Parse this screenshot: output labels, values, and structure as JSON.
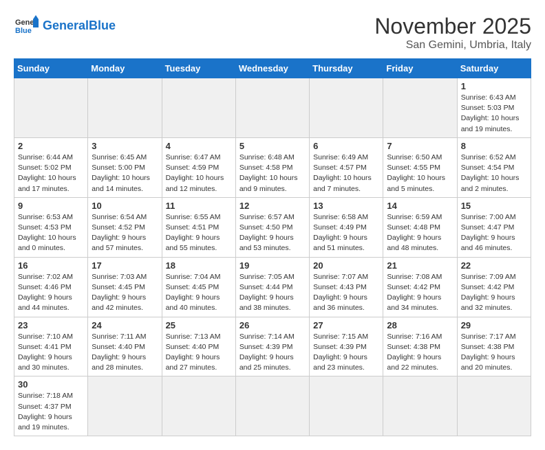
{
  "header": {
    "logo_general": "General",
    "logo_blue": "Blue",
    "month_title": "November 2025",
    "location": "San Gemini, Umbria, Italy"
  },
  "weekdays": [
    "Sunday",
    "Monday",
    "Tuesday",
    "Wednesday",
    "Thursday",
    "Friday",
    "Saturday"
  ],
  "weeks": [
    [
      {
        "day": "",
        "info": ""
      },
      {
        "day": "",
        "info": ""
      },
      {
        "day": "",
        "info": ""
      },
      {
        "day": "",
        "info": ""
      },
      {
        "day": "",
        "info": ""
      },
      {
        "day": "",
        "info": ""
      },
      {
        "day": "1",
        "info": "Sunrise: 6:43 AM\nSunset: 5:03 PM\nDaylight: 10 hours and 19 minutes."
      }
    ],
    [
      {
        "day": "2",
        "info": "Sunrise: 6:44 AM\nSunset: 5:02 PM\nDaylight: 10 hours and 17 minutes."
      },
      {
        "day": "3",
        "info": "Sunrise: 6:45 AM\nSunset: 5:00 PM\nDaylight: 10 hours and 14 minutes."
      },
      {
        "day": "4",
        "info": "Sunrise: 6:47 AM\nSunset: 4:59 PM\nDaylight: 10 hours and 12 minutes."
      },
      {
        "day": "5",
        "info": "Sunrise: 6:48 AM\nSunset: 4:58 PM\nDaylight: 10 hours and 9 minutes."
      },
      {
        "day": "6",
        "info": "Sunrise: 6:49 AM\nSunset: 4:57 PM\nDaylight: 10 hours and 7 minutes."
      },
      {
        "day": "7",
        "info": "Sunrise: 6:50 AM\nSunset: 4:55 PM\nDaylight: 10 hours and 5 minutes."
      },
      {
        "day": "8",
        "info": "Sunrise: 6:52 AM\nSunset: 4:54 PM\nDaylight: 10 hours and 2 minutes."
      }
    ],
    [
      {
        "day": "9",
        "info": "Sunrise: 6:53 AM\nSunset: 4:53 PM\nDaylight: 10 hours and 0 minutes."
      },
      {
        "day": "10",
        "info": "Sunrise: 6:54 AM\nSunset: 4:52 PM\nDaylight: 9 hours and 57 minutes."
      },
      {
        "day": "11",
        "info": "Sunrise: 6:55 AM\nSunset: 4:51 PM\nDaylight: 9 hours and 55 minutes."
      },
      {
        "day": "12",
        "info": "Sunrise: 6:57 AM\nSunset: 4:50 PM\nDaylight: 9 hours and 53 minutes."
      },
      {
        "day": "13",
        "info": "Sunrise: 6:58 AM\nSunset: 4:49 PM\nDaylight: 9 hours and 51 minutes."
      },
      {
        "day": "14",
        "info": "Sunrise: 6:59 AM\nSunset: 4:48 PM\nDaylight: 9 hours and 48 minutes."
      },
      {
        "day": "15",
        "info": "Sunrise: 7:00 AM\nSunset: 4:47 PM\nDaylight: 9 hours and 46 minutes."
      }
    ],
    [
      {
        "day": "16",
        "info": "Sunrise: 7:02 AM\nSunset: 4:46 PM\nDaylight: 9 hours and 44 minutes."
      },
      {
        "day": "17",
        "info": "Sunrise: 7:03 AM\nSunset: 4:45 PM\nDaylight: 9 hours and 42 minutes."
      },
      {
        "day": "18",
        "info": "Sunrise: 7:04 AM\nSunset: 4:45 PM\nDaylight: 9 hours and 40 minutes."
      },
      {
        "day": "19",
        "info": "Sunrise: 7:05 AM\nSunset: 4:44 PM\nDaylight: 9 hours and 38 minutes."
      },
      {
        "day": "20",
        "info": "Sunrise: 7:07 AM\nSunset: 4:43 PM\nDaylight: 9 hours and 36 minutes."
      },
      {
        "day": "21",
        "info": "Sunrise: 7:08 AM\nSunset: 4:42 PM\nDaylight: 9 hours and 34 minutes."
      },
      {
        "day": "22",
        "info": "Sunrise: 7:09 AM\nSunset: 4:42 PM\nDaylight: 9 hours and 32 minutes."
      }
    ],
    [
      {
        "day": "23",
        "info": "Sunrise: 7:10 AM\nSunset: 4:41 PM\nDaylight: 9 hours and 30 minutes."
      },
      {
        "day": "24",
        "info": "Sunrise: 7:11 AM\nSunset: 4:40 PM\nDaylight: 9 hours and 28 minutes."
      },
      {
        "day": "25",
        "info": "Sunrise: 7:13 AM\nSunset: 4:40 PM\nDaylight: 9 hours and 27 minutes."
      },
      {
        "day": "26",
        "info": "Sunrise: 7:14 AM\nSunset: 4:39 PM\nDaylight: 9 hours and 25 minutes."
      },
      {
        "day": "27",
        "info": "Sunrise: 7:15 AM\nSunset: 4:39 PM\nDaylight: 9 hours and 23 minutes."
      },
      {
        "day": "28",
        "info": "Sunrise: 7:16 AM\nSunset: 4:38 PM\nDaylight: 9 hours and 22 minutes."
      },
      {
        "day": "29",
        "info": "Sunrise: 7:17 AM\nSunset: 4:38 PM\nDaylight: 9 hours and 20 minutes."
      }
    ],
    [
      {
        "day": "30",
        "info": "Sunrise: 7:18 AM\nSunset: 4:37 PM\nDaylight: 9 hours and 19 minutes."
      },
      {
        "day": "",
        "info": ""
      },
      {
        "day": "",
        "info": ""
      },
      {
        "day": "",
        "info": ""
      },
      {
        "day": "",
        "info": ""
      },
      {
        "day": "",
        "info": ""
      },
      {
        "day": "",
        "info": ""
      }
    ]
  ]
}
